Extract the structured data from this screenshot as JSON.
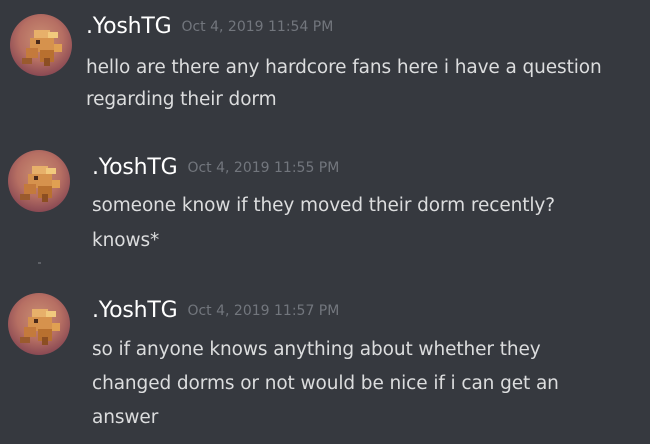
{
  "messages": [
    {
      "author": ".YoshTG",
      "timestamp": "Oct 4, 2019 11:54 PM",
      "avatar_icon": "pixel-monster-avatar",
      "lines": [
        "hello are there any hardcore fans here i have a question",
        "regarding their dorm"
      ]
    },
    {
      "author": ".YoshTG",
      "timestamp": "Oct 4, 2019 11:55 PM",
      "avatar_icon": "pixel-monster-avatar",
      "lines": [
        "someone know if they moved their dorm recently?",
        "knows*"
      ]
    },
    {
      "author": ".YoshTG",
      "timestamp": "Oct 4, 2019 11:57 PM",
      "avatar_icon": "pixel-monster-avatar",
      "lines": [
        "so if anyone knows anything about whether they",
        "changed dorms or not would be nice if i can get an",
        "answer"
      ]
    }
  ],
  "colors": {
    "background": "#36393f",
    "username": "#ffffff",
    "timestamp": "#72767d",
    "message_text": "#dcddde"
  }
}
